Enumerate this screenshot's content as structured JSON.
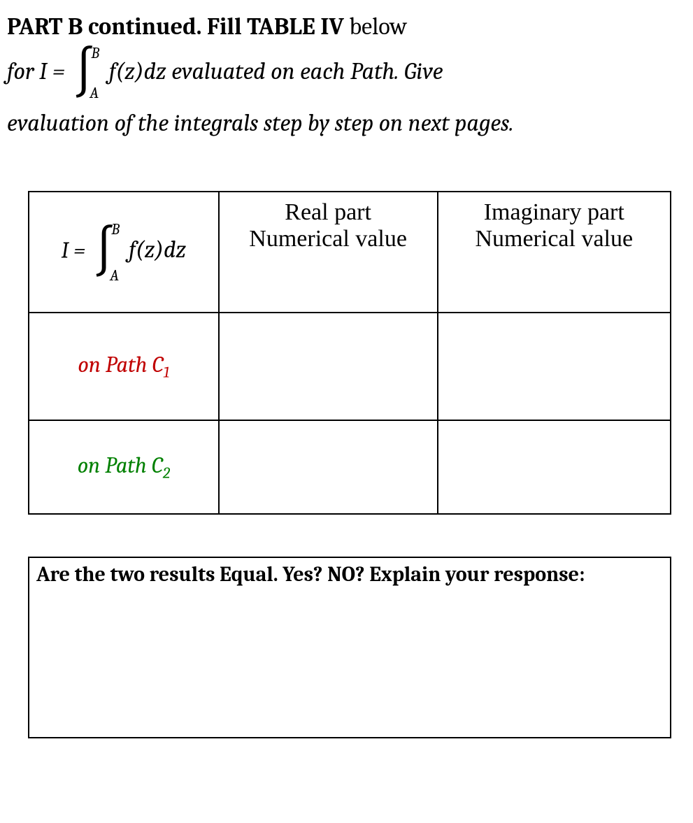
{
  "heading": {
    "bold": "PART B continued.  Fill TABLE IV",
    "tail": " below"
  },
  "instruction": {
    "pre_for": "for  I",
    "eq": " = ",
    "upper": "B",
    "lower": "A",
    "integrand": "f(z)dz",
    "post": "  evaluated on each Path.  Give",
    "line2": "evaluation of the integrals step by step on next pages."
  },
  "table": {
    "header": {
      "cell0_prefix": "I = ",
      "integrand": "f(z)dz",
      "upper": "B",
      "lower": "A",
      "col1_line1": "Real part",
      "col1_line2": "Numerical value",
      "col2_line1": "Imaginary part",
      "col2_line2": "Numerical value"
    },
    "rows": [
      {
        "label_before": "on Path C",
        "sub": "1",
        "real": "",
        "imag": "",
        "color": "red"
      },
      {
        "label_before": "on Path C",
        "sub": "2",
        "real": "",
        "imag": "",
        "color": "grn"
      }
    ]
  },
  "explain": {
    "q1": "Are the two results Equal.  Yes? NO?",
    "q2": "  Explain your response:"
  }
}
